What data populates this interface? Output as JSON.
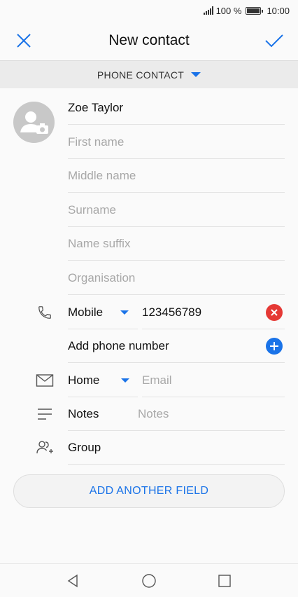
{
  "status": {
    "battery": "100 %",
    "time": "10:00"
  },
  "header": {
    "title": "New contact",
    "close_icon": "close-icon",
    "confirm_icon": "checkmark-icon"
  },
  "account": {
    "label": "PHONE CONTACT"
  },
  "name_fields": {
    "display_name": "Zoe Taylor",
    "first_name_placeholder": "First name",
    "middle_name_placeholder": "Middle name",
    "surname_placeholder": "Surname",
    "suffix_placeholder": "Name suffix",
    "organisation_placeholder": "Organisation"
  },
  "phone": {
    "type": "Mobile",
    "number": "123456789",
    "add_label": "Add phone number"
  },
  "email": {
    "type": "Home",
    "placeholder": "Email"
  },
  "notes": {
    "label": "Notes",
    "placeholder": "Notes"
  },
  "group": {
    "label": "Group"
  },
  "add_field": {
    "label": "ADD ANOTHER FIELD"
  },
  "colors": {
    "accent": "#1a73e8",
    "delete": "#e53935"
  }
}
